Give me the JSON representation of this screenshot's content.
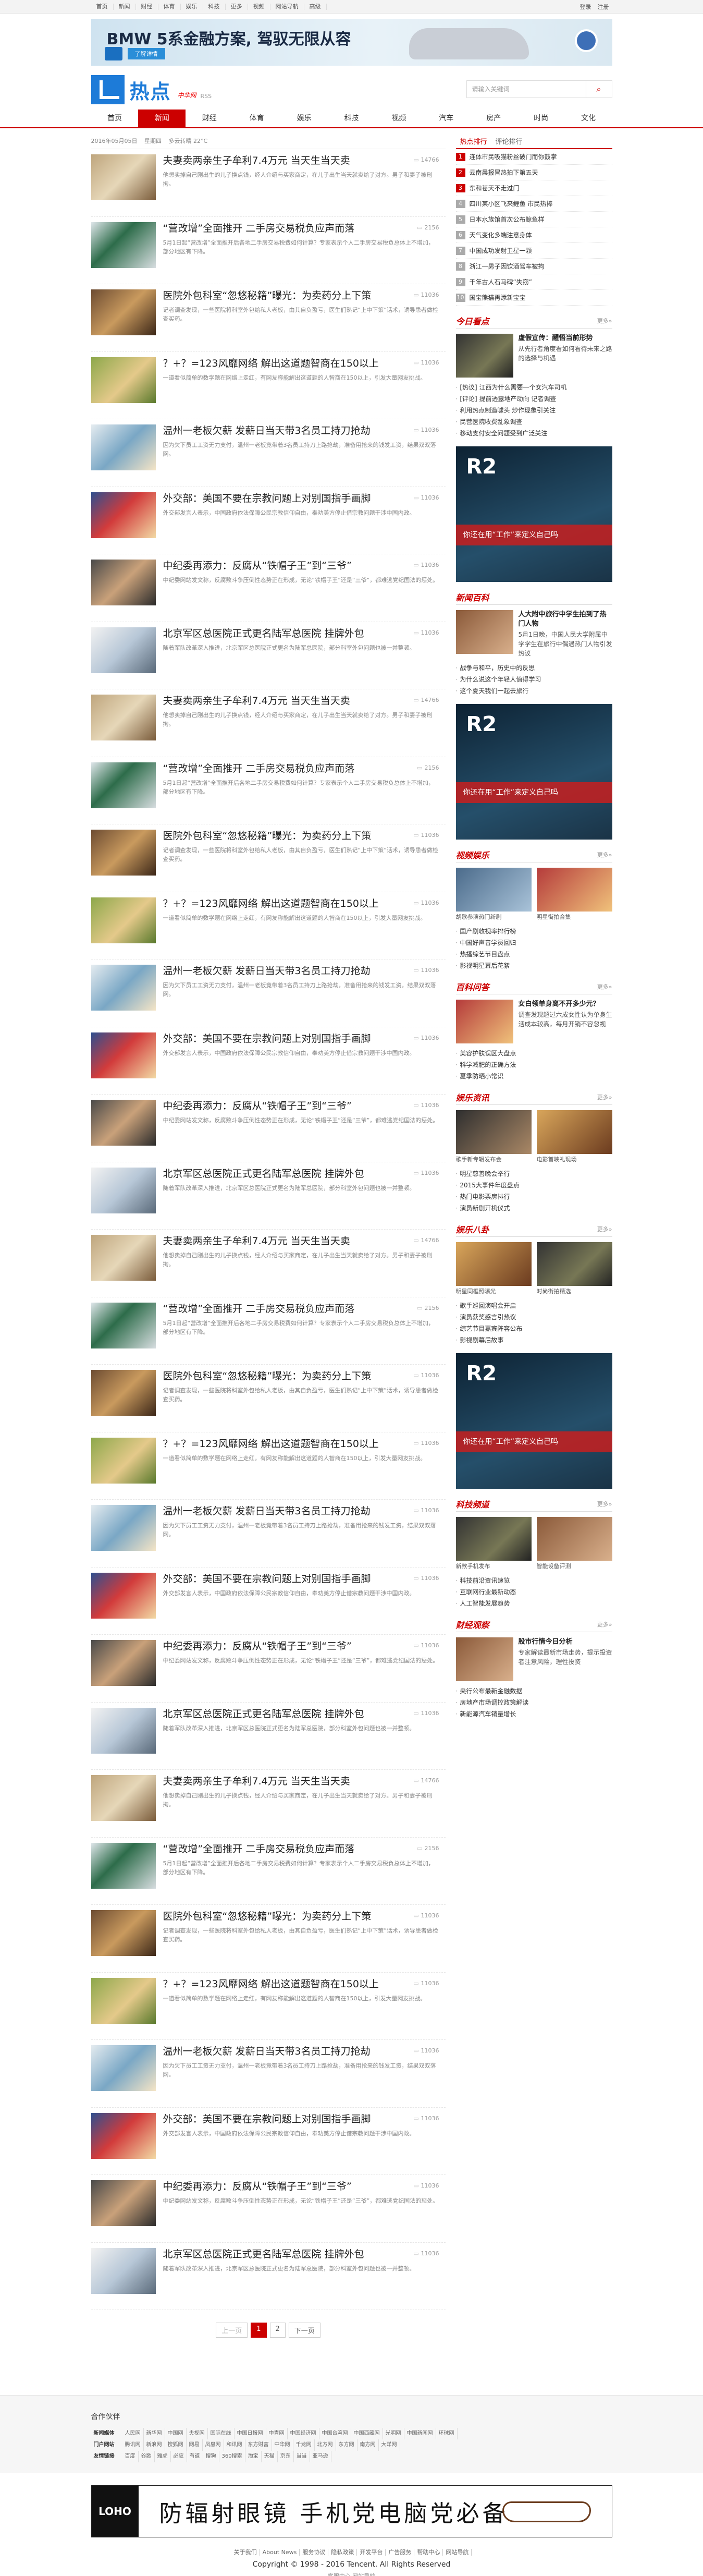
{
  "topnav": [
    "首页",
    "新闻",
    "财经",
    "体育",
    "娱乐",
    "科技",
    "更多",
    "视频",
    "网站导航",
    "高级"
  ],
  "toplogin": [
    "登录",
    "注册"
  ],
  "banner": {
    "title": "BMW 5系金融方案, 驾驭无限从容",
    "button": "了解详情"
  },
  "logo": {
    "text": "热点",
    "sub": "中华网",
    "rss": "RSS"
  },
  "search": {
    "placeholder": "请输入关键词",
    "button": "搜索"
  },
  "nav": [
    "首页",
    "新闻",
    "财经",
    "体育",
    "娱乐",
    "科技",
    "视频",
    "汽车",
    "房产",
    "时尚",
    "文化"
  ],
  "nav_active": "新闻",
  "date": {
    "day": "2016年05月05日",
    "weekday": "星期四",
    "weather": "多云转晴 22°C"
  },
  "articles_base": [
    {
      "title": "夫妻卖两亲生子牟利7.4万元 当天生当天卖",
      "desc": "他想卖掉自己刚出生的儿子换点钱，经人介绍与买家商定，在儿子出生当天就卖给了对方。男子和妻子被刑拘。",
      "comments": "14766"
    },
    {
      "title": "“营改增”全面推开 二手房交易税负应声而落",
      "desc": "5月1日起“营改增”全面推开后各地二手房交易税费如何计算？专家表示个人二手房交易税负总体上不增加，部分地区有下降。",
      "comments": "2156"
    },
    {
      "title": "医院外包科室“忽悠秘籍”曝光：为卖药分上下策",
      "desc": "记者调查发现，一些医院将科室外包给私人老板，由其自负盈亏，医生们熟记“上中下策”话术，诱导患者做检查买药。",
      "comments": "11036"
    },
    {
      "title": "？+？=123风靡网络 解出这道题智商在150以上",
      "desc": "一道看似简单的数学题在网络上走红，有网友称能解出这道题的人智商在150以上，引发大量网友挑战。",
      "comments": "11036"
    },
    {
      "title": "温州一老板欠薪 发薪日当天带3名员工持刀抢劫",
      "desc": "因为欠下员工工资无力支付，温州一老板竟带着3名员工持刀上路抢劫，准备用抢来的钱发工资，结果双双落网。",
      "comments": "11036"
    },
    {
      "title": "外交部：美国不要在宗教问题上对别国指手画脚",
      "desc": "外交部发言人表示，中国政府依法保障公民宗教信仰自由，奉劝美方停止借宗教问题干涉中国内政。",
      "comments": "11036"
    },
    {
      "title": "中纪委再添力：反腐从“铁帽子王”到“三爷”",
      "desc": "中纪委网站发文称，反腐败斗争压倒性态势正在形成，无论“铁帽子王”还是“三爷”，都难逃党纪国法的惩处。",
      "comments": "11036"
    },
    {
      "title": "北京军区总医院正式更名陆军总医院 挂牌外包",
      "desc": "随着军队改革深入推进，北京军区总医院正式更名为陆军总医院，部分科室外包问题也被一并整顿。",
      "comments": "11036"
    }
  ],
  "pager": {
    "prev": "上一页",
    "pages": [
      "1",
      "2"
    ],
    "next": "下一页",
    "current": "1"
  },
  "hot": {
    "tabs": [
      "热点排行",
      "评论排行"
    ],
    "items": [
      "连体市民吸猫粉丝破门而你鼓掌",
      "云南晨报冒热拍下第五天",
      "东和苍天不走过门",
      "四川某小区飞来鲤鱼 市民热捧",
      "日本水族馆首次公布鲸鱼样",
      "天气变化多端注意身体",
      "中国成功发射卫星一颗",
      "浙江一男子因饮酒驾车被拘",
      "千年古人石马碑“失窃”",
      "国宝熊猫再添新宝宝"
    ]
  },
  "section_pic": {
    "tag": "今日看点",
    "more": "更多»",
    "feature": {
      "title": "虚假宣传：醒悟当前形势",
      "text": "从先行者角度看如何看待未来之路的选择与机遇"
    },
    "list": [
      "[热议] 江西为什么需要一个女汽车司机",
      "[评论] 提前透露地产动向 记者调查",
      "利用热点制造噱头 炒作现象引关注",
      "民营医院收费乱象调查",
      "移动支付安全问题受到广泛关注"
    ]
  },
  "ad_r2": {
    "brand": "R2",
    "band": "你还在用“工作”来定义自己吗"
  },
  "news_brief": {
    "tag": "新闻百科",
    "feature": {
      "title": "人大附中旅行中学生拍到了热门人物",
      "text": "5月1日晚，中国人民大学附属中学学生在旅行中偶遇热门人物引发热议"
    },
    "list": [
      "战争与和平，历史中的反思",
      "为什么说这个年轻人值得学习",
      "这个夏天我们一起去旅行"
    ]
  },
  "video_sec": {
    "tag": "视频娱乐",
    "more": "更多»",
    "grid": [
      {
        "cap": "胡歌参演热门新剧"
      },
      {
        "cap": "明星街拍合集"
      }
    ],
    "list": [
      "国产剧收视率排行榜",
      "中国好声音学员回归",
      "热播综艺节目盘点",
      "影视明星幕后花絮"
    ]
  },
  "qa_sec": {
    "tag": "百科问答",
    "more": "更多»",
    "feature": {
      "title": "女白领单身离不开多少元？",
      "text": "调查发现超过六成女性认为单身生活成本较高，每月开销不容忽视"
    },
    "list": [
      "美容护肤误区大盘点",
      "科学减肥的正确方法",
      "夏季防晒小常识"
    ]
  },
  "ent_sec": {
    "tag": "娱乐资讯",
    "more": "更多»",
    "grid": [
      {
        "cap": "歌手新专辑发布会"
      },
      {
        "cap": "电影首映礼现场"
      }
    ],
    "list": [
      "明星慈善晚会举行",
      "2015大事件年度盘点",
      "热门电影票房排行",
      "演员新剧开机仪式"
    ]
  },
  "ent_sec2": {
    "tag": "娱乐八卦",
    "more": "更多»",
    "grid": [
      {
        "cap": "明星同框照曝光"
      },
      {
        "cap": "时尚街拍精选"
      }
    ],
    "list": [
      "歌手巡回演唱会开启",
      "演员获奖感言引热议",
      "综艺节目嘉宾阵容公布",
      "影视剧幕后故事"
    ]
  },
  "ad_r2b": {
    "brand": "R2",
    "band": "你还在用“工作”来定义自己吗"
  },
  "tech_sec": {
    "tag": "科技频道",
    "more": "更多»",
    "grid": [
      {
        "cap": "新款手机发布"
      },
      {
        "cap": "智能设备评测"
      }
    ],
    "list": [
      "科技前沿资讯速览",
      "互联网行业最新动态",
      "人工智能发展趋势"
    ]
  },
  "finance_sec": {
    "tag": "财经观察",
    "more": "更多»",
    "feature": {
      "title": "股市行情今日分析",
      "text": "专家解读最新市场走势，提示投资者注意风险，理性投资"
    },
    "list": [
      "央行公布最新金融数据",
      "房地产市场调控政策解读",
      "新能源汽车销量增长"
    ]
  },
  "partners": {
    "title": "合作伙伴",
    "rows": [
      {
        "label": "新闻媒体",
        "items": [
          "人民网",
          "新华网",
          "中国网",
          "央视网",
          "国际在线",
          "中国日报网",
          "中青网",
          "中国经济网",
          "中国台湾网",
          "中国西藏网",
          "光明网",
          "中国新闻网",
          "环球网"
        ]
      },
      {
        "label": "门户网站",
        "items": [
          "腾讯网",
          "新浪网",
          "搜狐网",
          "网易",
          "凤凰网",
          "和讯网",
          "东方财富",
          "中华网",
          "千龙网",
          "北方网",
          "东方网",
          "南方网",
          "大洋网"
        ]
      },
      {
        "label": "友情链接",
        "items": [
          "百度",
          "谷歌",
          "雅虎",
          "必应",
          "有道",
          "搜狗",
          "360搜索",
          "淘宝",
          "天猫",
          "京东",
          "当当",
          "亚马逊"
        ]
      }
    ]
  },
  "footer_ad": {
    "logo": "LOHO",
    "slogan": "防辐射眼镜 手机党电脑党必备"
  },
  "footer": {
    "links": [
      "关于我们",
      "About News",
      "服务协议",
      "隐私政策",
      "开发平台",
      "广告服务",
      "帮助中心",
      "网站导航"
    ],
    "copyright": "Copyright © 1998 - 2016 Tencent. All Rights Reserved",
    "sub": "客服中心  网站导航"
  }
}
